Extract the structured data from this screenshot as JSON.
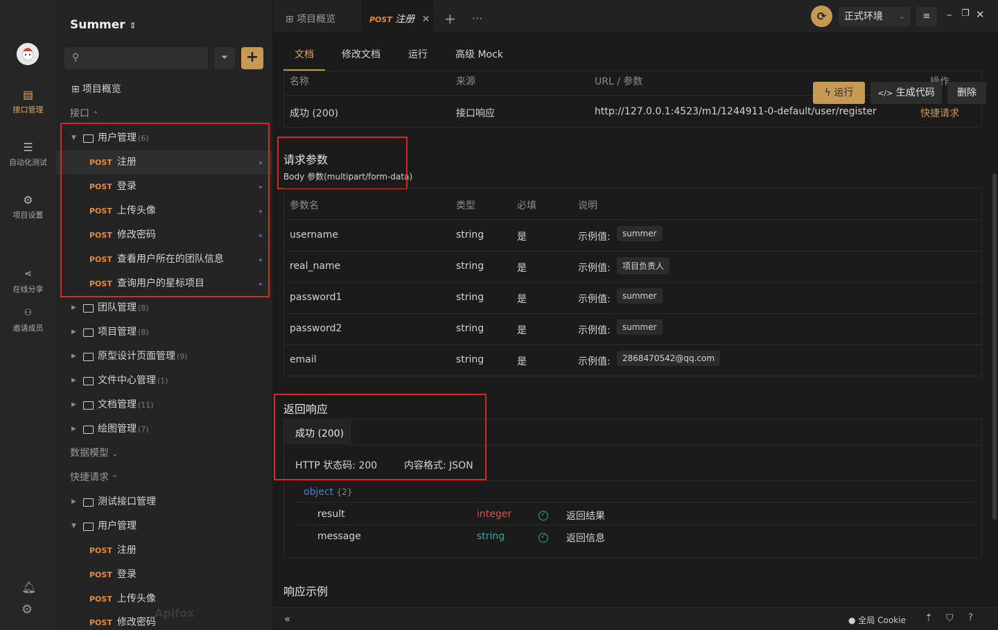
{
  "rail": {
    "items": [
      {
        "label": "接口管理",
        "icon": "api-icon",
        "active": true
      },
      {
        "label": "自动化测试",
        "icon": "automation-icon"
      },
      {
        "label": "项目设置",
        "icon": "settings-icon"
      },
      {
        "label": "在线分享",
        "icon": "share-icon"
      },
      {
        "label": "邀请成员",
        "icon": "invite-icon"
      }
    ],
    "bottom_icons": [
      "bell-icon",
      "gear-icon"
    ]
  },
  "tree": {
    "project_name": "Summer",
    "search_placeholder": "",
    "overview": "项目概览",
    "section_api": "接口",
    "user_folder": {
      "name": "用户管理",
      "count": "(6)"
    },
    "user_items": [
      {
        "method": "POST",
        "name": "注册"
      },
      {
        "method": "POST",
        "name": "登录"
      },
      {
        "method": "POST",
        "name": "上传头像"
      },
      {
        "method": "POST",
        "name": "修改密码"
      },
      {
        "method": "POST",
        "name": "查看用户所在的团队信息"
      },
      {
        "method": "POST",
        "name": "查询用户的星标项目"
      }
    ],
    "folders": [
      {
        "name": "团队管理",
        "count": "(8)"
      },
      {
        "name": "项目管理",
        "count": "(8)"
      },
      {
        "name": "原型设计页面管理",
        "count": "(9)"
      },
      {
        "name": "文件中心管理",
        "count": "(1)"
      },
      {
        "name": "文档管理",
        "count": "(11)"
      },
      {
        "name": "绘图管理",
        "count": "(7)"
      }
    ],
    "section_models": "数据模型",
    "section_quick": "快捷请求",
    "quick_folders": [
      {
        "name": "测试接口管理"
      },
      {
        "name": "用户管理"
      }
    ],
    "quick_items": [
      {
        "method": "POST",
        "name": "注册"
      },
      {
        "method": "POST",
        "name": "登录"
      },
      {
        "method": "POST",
        "name": "上传头像"
      },
      {
        "method": "POST",
        "name": "修改密码"
      }
    ],
    "watermark": "Apifox"
  },
  "tabs": {
    "overview": "项目概览",
    "active_method": "POST",
    "active_name": "注册",
    "env": "正式环境"
  },
  "subtabs": [
    "文档",
    "修改文档",
    "运行",
    "高级 Mock"
  ],
  "response_table": {
    "headers": [
      "名称",
      "来源",
      "URL / 参数",
      "操作"
    ],
    "row": {
      "name": "成功 (200)",
      "source": "接口响应",
      "url": "http://127.0.0.1:4523/m1/1244911-0-default/user/register",
      "action": "快捷请求"
    },
    "buttons": {
      "run": "运行",
      "gen": "生成代码",
      "del": "删除"
    }
  },
  "request": {
    "title": "请求参数",
    "body_label": "Body 参数(multipart/form-data)",
    "headers": [
      "参数名",
      "类型",
      "必填",
      "说明"
    ],
    "example_label": "示例值:",
    "params": [
      {
        "name": "username",
        "type": "string",
        "required": "是",
        "example": "summer"
      },
      {
        "name": "real_name",
        "type": "string",
        "required": "是",
        "example": "项目负责人"
      },
      {
        "name": "password1",
        "type": "string",
        "required": "是",
        "example": "summer"
      },
      {
        "name": "password2",
        "type": "string",
        "required": "是",
        "example": "summer"
      },
      {
        "name": "email",
        "type": "string",
        "required": "是",
        "example": "2868470542@qq.com"
      }
    ]
  },
  "response": {
    "title": "返回响应",
    "tab": "成功 (200)",
    "status": "HTTP 状态码: 200",
    "format": "内容格式: JSON",
    "object_label": "object",
    "object_count": "{2}",
    "fields": [
      {
        "name": "result",
        "type": "integer",
        "desc": "返回结果",
        "type_color": "#e0533f"
      },
      {
        "name": "message",
        "type": "string",
        "desc": "返回信息",
        "type_color": "#3ba5a0"
      }
    ],
    "example_title": "响应示例"
  },
  "bottombar": {
    "cookie": "全局 Cookie"
  },
  "colors": {
    "accent": "#c79a53",
    "post": "#e88b3a",
    "highlight_box": "#e02424"
  }
}
